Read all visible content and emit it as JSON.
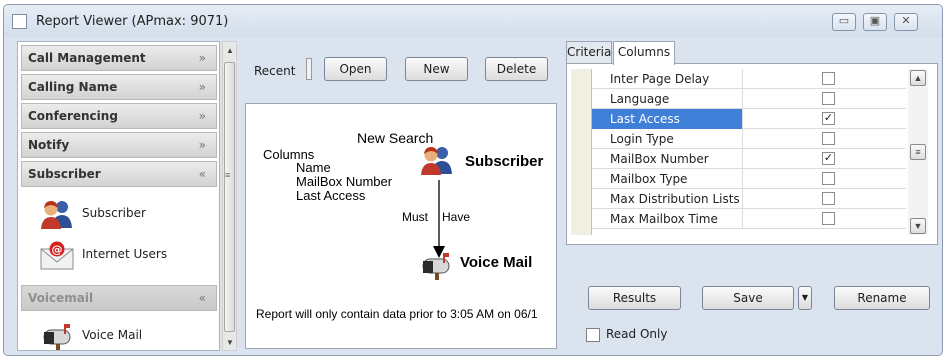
{
  "window": {
    "title": "Report Viewer (APmax: 9071)",
    "controls": [
      "minimize",
      "maximize",
      "close"
    ]
  },
  "sidebar": {
    "sections": [
      {
        "label": "Call Management"
      },
      {
        "label": "Calling Name"
      },
      {
        "label": "Conferencing"
      },
      {
        "label": "Notify"
      },
      {
        "label": "Subscriber",
        "expanded": true
      },
      {
        "label": "Voicemail",
        "disabled": true
      }
    ],
    "items": [
      {
        "label": "Subscriber",
        "icon": "users-icon"
      },
      {
        "label": "Internet Users",
        "icon": "email-icon"
      },
      {
        "label": "Voice Mail",
        "icon": "mailbox-icon"
      }
    ]
  },
  "toolbar": {
    "recent_label": "Recent",
    "open_label": "Open",
    "new_label": "New",
    "delete_label": "Delete"
  },
  "diagram": {
    "heading": "New Search",
    "columns_label": "Columns",
    "columns": [
      "Name",
      "MailBox  Number",
      "Last Access"
    ],
    "source_node": "Subscriber",
    "relation_left": "Must",
    "relation_right": "Have",
    "target_node": "Voice Mail",
    "footer": "Report will only contain data prior to 3:05 AM on 06/1"
  },
  "tabs": [
    {
      "label": "Criteria"
    },
    {
      "label": "Columns",
      "active": true
    }
  ],
  "columns_grid": {
    "rows": [
      {
        "name": "Inter Page Delay",
        "checked": false
      },
      {
        "name": "Language",
        "checked": false
      },
      {
        "name": "Last Access",
        "checked": true,
        "selected": true
      },
      {
        "name": "Login Type",
        "checked": false
      },
      {
        "name": "MailBox Number",
        "checked": true
      },
      {
        "name": "Mailbox Type",
        "checked": false
      },
      {
        "name": "Max Distribution Lists",
        "checked": false
      },
      {
        "name": "Max Mailbox Time",
        "checked": false
      }
    ]
  },
  "actions": {
    "results_label": "Results",
    "save_label": "Save",
    "rename_label": "Rename"
  },
  "read_only": {
    "label": "Read Only",
    "checked": false
  },
  "colors": {
    "selection": "#3f7fd8",
    "window_bg": "#dbe3ee"
  }
}
